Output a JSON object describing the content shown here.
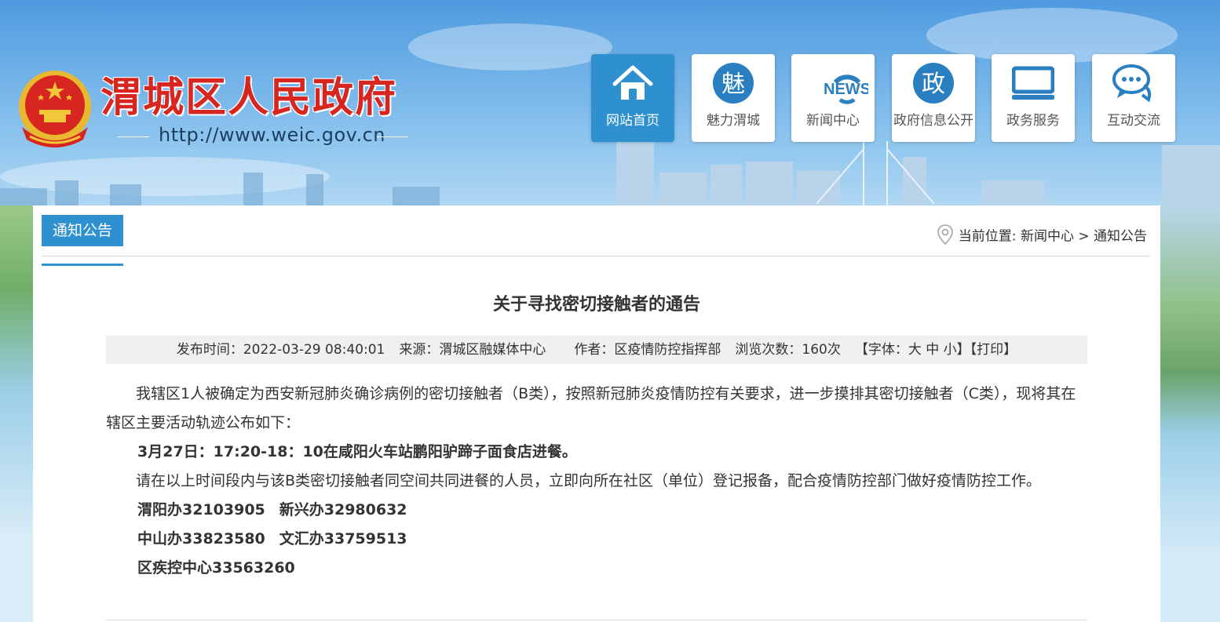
{
  "header": {
    "site_title": "渭城区人民政府",
    "site_url": "http://www.weic.gov.cn"
  },
  "nav": {
    "items": [
      {
        "label": "网站首页",
        "icon": "home-icon",
        "active": true
      },
      {
        "label": "魅力渭城",
        "icon": "charm-icon",
        "glyph": "魅"
      },
      {
        "label": "新闻中心",
        "icon": "news-icon",
        "glyph": "NEWS"
      },
      {
        "label": "政府信息公开",
        "icon": "government-icon",
        "glyph": "政"
      },
      {
        "label": "政务服务",
        "icon": "monitor-icon"
      },
      {
        "label": "互动交流",
        "icon": "chat-bubble-icon"
      }
    ]
  },
  "section": {
    "tab_label": "通知公告",
    "breadcrumb": "当前位置: 新闻中心 > 通知公告"
  },
  "article": {
    "title": "关于寻找密切接触者的通告",
    "meta": {
      "publish_time": "发布时间：2022-03-29 08:40:01",
      "source": "来源：渭城区融媒体中心",
      "author": "作者：区疫情防控指挥部",
      "views": "浏览次数：160次",
      "font_prefix": "【字体：",
      "font_large": "大",
      "font_medium": "中",
      "font_small": "小",
      "font_suffix": "】",
      "print": "【打印】"
    },
    "paragraph_1": "我辖区1人被确定为西安新冠肺炎确诊病例的密切接触者（B类），按照新冠肺炎疫情防控有关要求，进一步摸排其密切接触者（C类），现将其在辖区主要活动轨迹公布如下：",
    "track": "3月27日：17:20-18：10在咸阳火车站鹏阳驴蹄子面食店进餐。",
    "paragraph_2": "请在以上时间段内与该B类密切接触者同空间共同进餐的人员，立即向所在社区（单位）登记报备，配合疫情防控部门做好疫情防控工作。",
    "contacts": [
      [
        "渭阳办32103905",
        "新兴办32980632"
      ],
      [
        "中山办33823580",
        "文汇办33759513"
      ],
      [
        "区疾控中心33563260"
      ]
    ]
  },
  "colors": {
    "brand_red": "#d7261f",
    "accent_blue": "#2f90cf"
  }
}
